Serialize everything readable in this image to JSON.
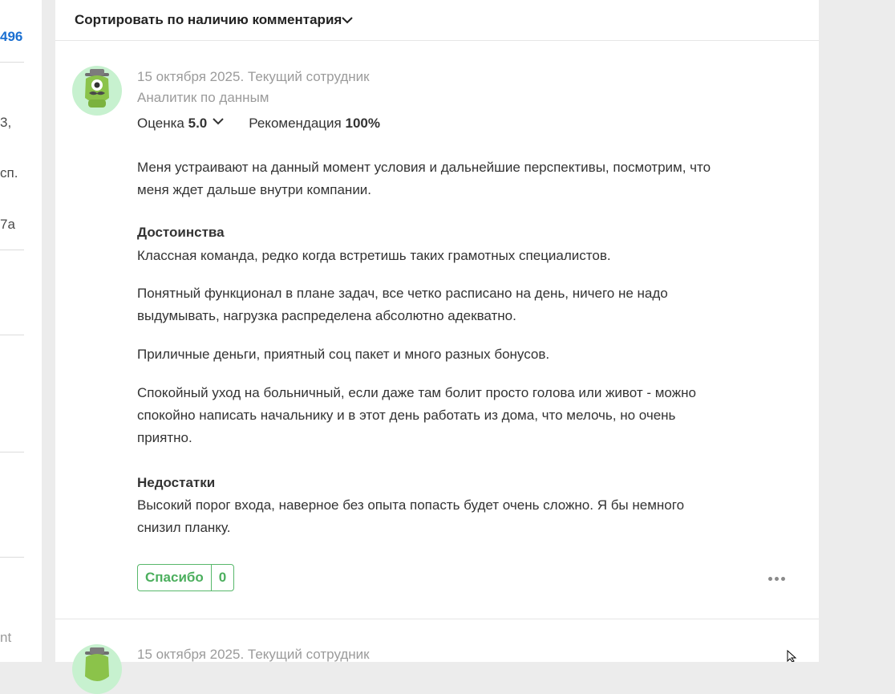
{
  "left_column": {
    "link_number": "496",
    "fragment_1": "3,",
    "fragment_2": "сп.",
    "fragment_3": "7а",
    "fragment_4": "nt"
  },
  "sort_bar": {
    "label": "Сортировать по наличию комментария",
    "icon": "chevron-down-icon"
  },
  "reviews": [
    {
      "avatar_icon": "monster-mascot-icon",
      "date_status": "15 октября 2025. Текущий сотрудник",
      "position": "Аналитик по данным",
      "rating_label": "Оценка",
      "rating_value": "5.0",
      "recommendation_label": "Рекомендация",
      "recommendation_value": "100%",
      "summary": "Меня устраивают на данный момент условия и дальнейшие перспективы, посмотрим, что меня ждет дальше внутри компании.",
      "pros_title": "Достоинства",
      "pros": [
        "Классная команда, редко когда встретишь таких грамотных специалистов.",
        "Понятный функционал в плане задач, все четко расписано на день, ничего не надо выдумывать, нагрузка распределена абсолютно адекватно.",
        "Приличные деньги, приятный соц пакет и много разных бонусов.",
        "Спокойный уход на больничный, если даже там болит просто голова или живот - можно спокойно написать начальнику и в этот день работать из дома, что мелочь, но очень приятно."
      ],
      "cons_title": "Недостатки",
      "cons": "Высокий порог входа, наверное без опыта попасть будет очень сложно. Я бы немного снизил планку.",
      "thanks_label": "Спасибо",
      "thanks_count": "0",
      "more_icon": "more-horizontal-icon"
    },
    {
      "avatar_icon": "monster-mascot-icon",
      "date_status": "15 октября 2025. Текущий сотрудник"
    }
  ],
  "colors": {
    "page_bg": "#ececec",
    "card_bg": "#ffffff",
    "muted_text": "#9b9b9b",
    "accent_green": "#4caf5e",
    "link_blue": "#1a6fd1",
    "avatar_bg": "#c7f1cf"
  }
}
